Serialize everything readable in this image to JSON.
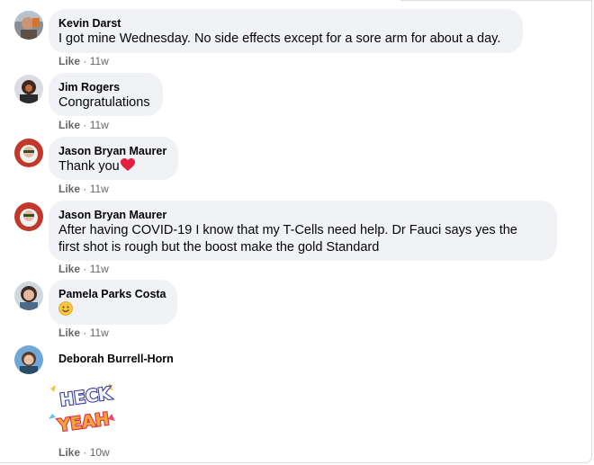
{
  "comments": [
    {
      "author": "Kevin Darst",
      "text": "I got mine Wednesday. No side effects except for a sore arm for about a day.",
      "like": "Like",
      "time": "11w"
    },
    {
      "author": "Jim Rogers",
      "text": "Congratulations",
      "like": "Like",
      "time": "11w"
    },
    {
      "author": "Jason Bryan Maurer",
      "text": "Thank you",
      "like": "Like",
      "time": "11w"
    },
    {
      "author": "Jason Bryan Maurer",
      "text_line1": "After having COVID-19 I know that my T-Cells need help. Dr Fauci says yes the",
      "text_line2": "first shot is rough but the boost make the gold Standard",
      "like": "Like",
      "time": "11w"
    },
    {
      "author": "Pamela Parks Costa",
      "like": "Like",
      "time": "11w"
    },
    {
      "author": "Deborah Burrell-Horn",
      "sticker_line1": "HECK",
      "sticker_line2": "YEAH",
      "like": "Like",
      "time": "10w"
    }
  ],
  "separator": "·",
  "colors": {
    "bubble": "#f0f2f5",
    "meta": "#65676b",
    "heart": "#e41e3f"
  },
  "icons": [
    "heart-emoji-icon",
    "smiley-emoji-icon",
    "heck-yeah-sticker"
  ]
}
